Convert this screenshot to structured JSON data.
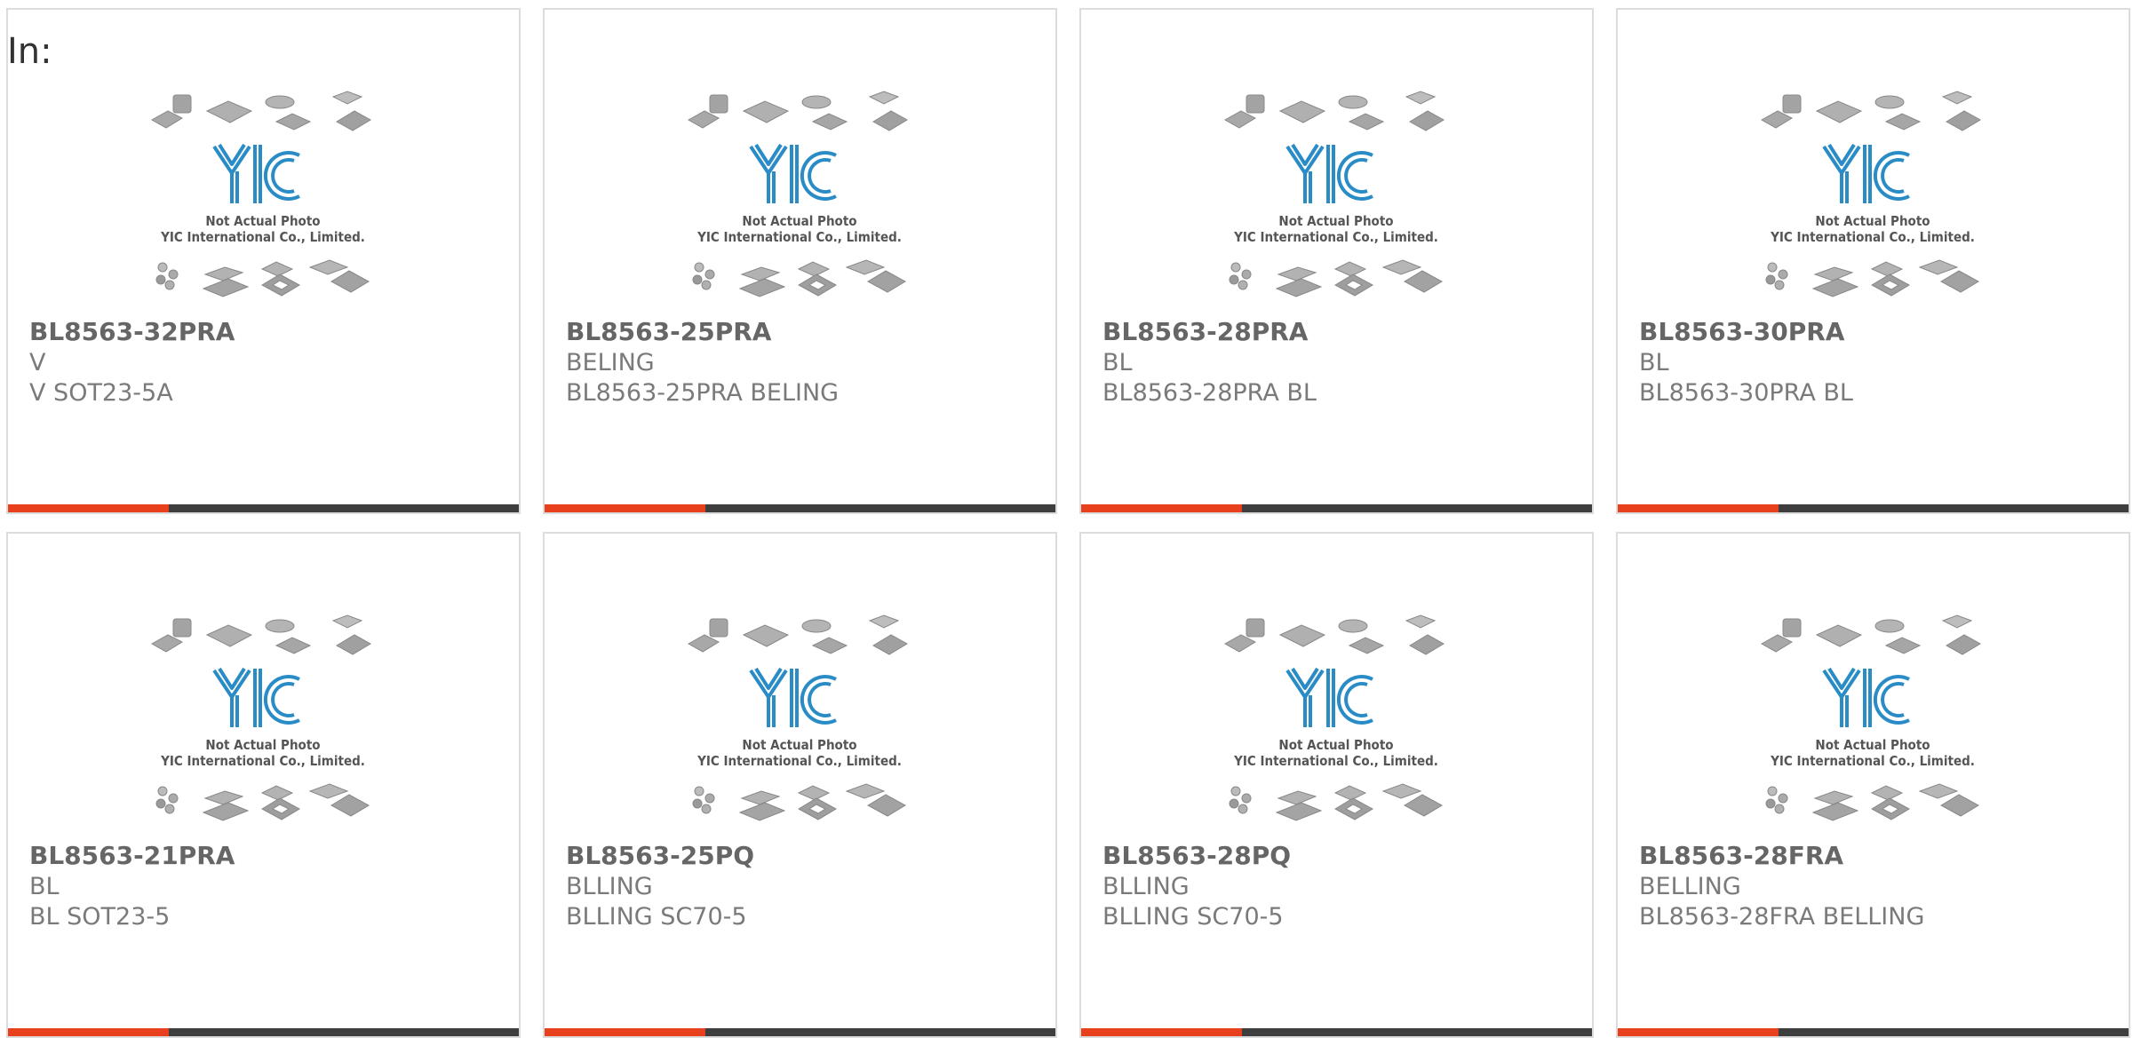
{
  "page": {
    "in_label": "In:",
    "colors": {
      "accent": "#e8401c",
      "bar": "#3e3e3e",
      "logo": "#2a8cc6",
      "text": "#7a7a7a",
      "border": "#dcdcdc"
    }
  },
  "placeholder": {
    "line1": "Not Actual Photo",
    "line2": "YIC International Co., Limited.",
    "logo_text": "YIC"
  },
  "products": [
    {
      "part": "BL8563-32PRA",
      "brand": "V",
      "desc": "V SOT23-5A"
    },
    {
      "part": "BL8563-25PRA",
      "brand": "BELING",
      "desc": "BL8563-25PRA BELING"
    },
    {
      "part": "BL8563-28PRA",
      "brand": "BL",
      "desc": "BL8563-28PRA BL"
    },
    {
      "part": "BL8563-30PRA",
      "brand": "BL",
      "desc": "BL8563-30PRA BL"
    },
    {
      "part": "BL8563-21PRA",
      "brand": "BL",
      "desc": "BL SOT23-5"
    },
    {
      "part": "BL8563-25PQ",
      "brand": "BLLING",
      "desc": "BLLING SC70-5"
    },
    {
      "part": "BL8563-28PQ",
      "brand": "BLLING",
      "desc": "BLLING SC70-5"
    },
    {
      "part": "BL8563-28FRA",
      "brand": "BELLING",
      "desc": "BL8563-28FRA BELLING"
    }
  ]
}
